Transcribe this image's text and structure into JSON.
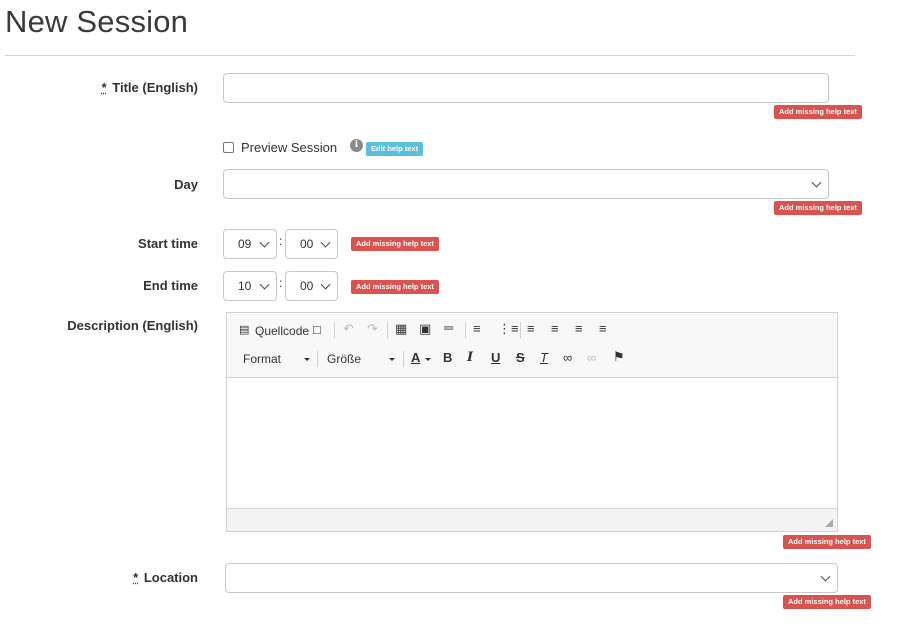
{
  "page": {
    "title": "New Session"
  },
  "required_marker": "*",
  "help": {
    "missing": "Add missing help text",
    "edit": "Edit help text"
  },
  "form": {
    "title": {
      "label": "Title (English)",
      "value": ""
    },
    "preview": {
      "label": "Preview Session",
      "checked": false
    },
    "day": {
      "label": "Day",
      "value": ""
    },
    "start_time": {
      "label": "Start time",
      "hour": "09",
      "minute": "00",
      "separator": ":"
    },
    "end_time": {
      "label": "End time",
      "hour": "10",
      "minute": "00",
      "separator": ":"
    },
    "description": {
      "label": "Description (English)"
    },
    "location": {
      "label": "Location",
      "value": ""
    }
  },
  "editor": {
    "source_label": "Quellcode",
    "format_label": "Format",
    "size_label": "Größe",
    "icons": [
      "source-icon",
      "preview-icon",
      "undo-icon",
      "redo-icon",
      "table-icon",
      "image-icon",
      "horizontal-line-icon",
      "numbered-list-icon",
      "bullet-list-icon",
      "align-left-icon",
      "align-center-icon",
      "align-right-icon",
      "justify-icon",
      "text-color-icon",
      "bold-icon",
      "italic-icon",
      "underline-icon",
      "strikethrough-icon",
      "remove-format-icon",
      "link-icon",
      "unlink-icon",
      "anchor-icon"
    ],
    "glyphs": {
      "text_color": "A",
      "bold": "B",
      "italic": "I",
      "underline": "U",
      "strike": "S",
      "remove_format": "T"
    }
  },
  "colors": {
    "danger": "#d9534f",
    "info": "#5bc0de",
    "border": "#c8c8c8"
  }
}
